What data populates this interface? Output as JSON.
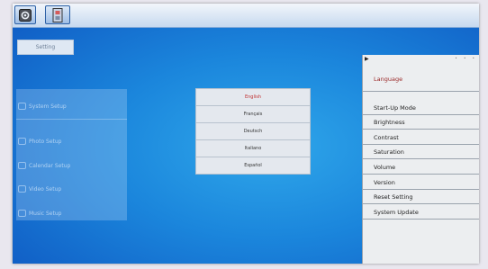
{
  "topbar": {
    "buttons": [
      {
        "icon": "settings-gear-icon"
      },
      {
        "icon": "film-strip-icon"
      }
    ]
  },
  "setting_tab": {
    "label": "Setting"
  },
  "left_menu": {
    "items": [
      {
        "label": "System Setup",
        "icon": "system-icon"
      },
      {
        "label": "Photo Setup",
        "icon": "photo-icon"
      },
      {
        "label": "Calendar Setup",
        "icon": "calendar-icon"
      },
      {
        "label": "Video Setup",
        "icon": "video-icon"
      },
      {
        "label": "Music Setup",
        "icon": "music-icon"
      }
    ]
  },
  "language_list": {
    "options": [
      "English",
      "Français",
      "Deutsch",
      "Italiano",
      "Español"
    ],
    "selected": "English"
  },
  "right_panel": {
    "header_label": "Language",
    "items": [
      "Start-Up Mode",
      "Brightness",
      "Contrast",
      "Saturation",
      "Volume",
      "Version",
      "Reset Setting",
      "System Update"
    ]
  },
  "colors": {
    "background_blue": "#1b86dc",
    "selected_red": "#c03030",
    "language_header_red": "#9b2a2a"
  }
}
